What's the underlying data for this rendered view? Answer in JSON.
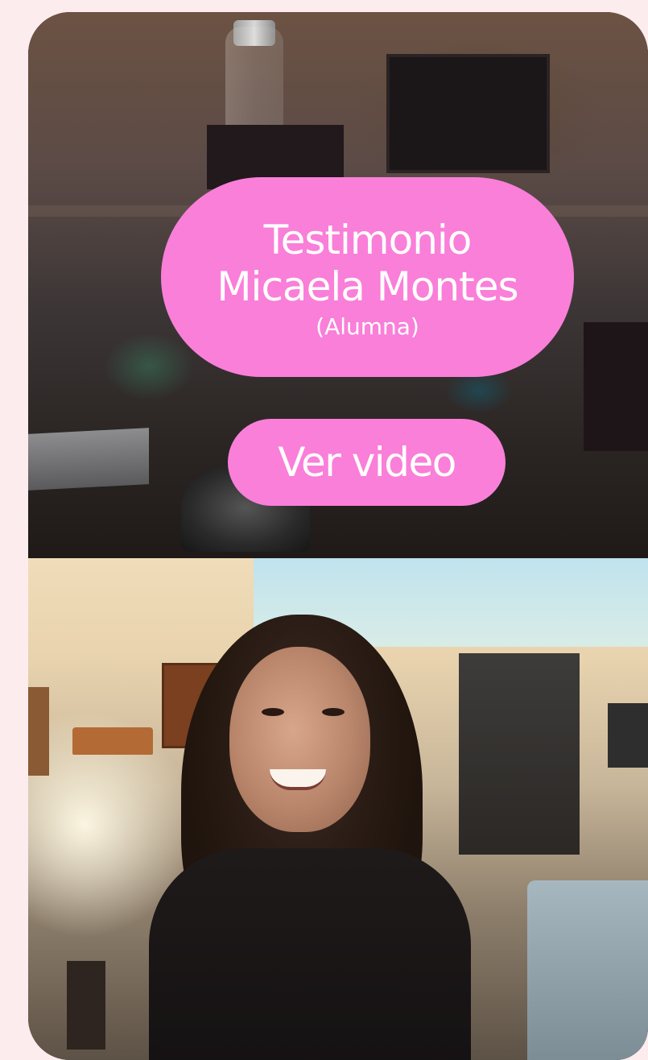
{
  "testimonial": {
    "title_line1": "Testimonio",
    "title_line2": "Micaela Montes",
    "subtitle": "(Alumna)",
    "cta_label": "Ver video"
  },
  "colors": {
    "page_background": "#fcecee",
    "pill_background": "#f97fd9",
    "pill_text": "#ffffff"
  }
}
